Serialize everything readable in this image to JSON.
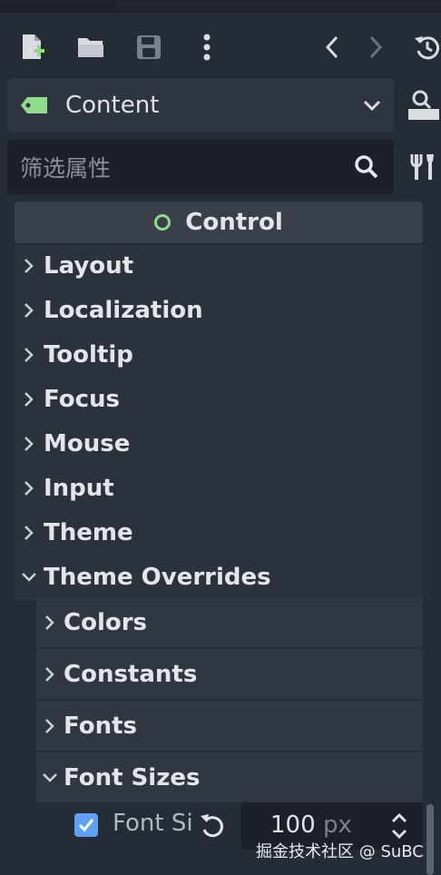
{
  "toolbar": {
    "icons": [
      "new-script-icon",
      "open-folder-icon",
      "save-icon",
      "more-vertical-icon",
      "back-icon",
      "forward-icon",
      "history-icon"
    ]
  },
  "resource": {
    "label": "Content"
  },
  "filter": {
    "placeholder": "筛选属性"
  },
  "section": {
    "title": "Control"
  },
  "categories": [
    "Layout",
    "Localization",
    "Tooltip",
    "Focus",
    "Mouse",
    "Input",
    "Theme",
    "Theme Overrides"
  ],
  "overrides": {
    "groups": [
      "Colors",
      "Constants",
      "Fonts",
      "Font Sizes"
    ]
  },
  "font_size_prop": {
    "label": "Font Si",
    "value": "100",
    "unit": "px",
    "checked": true
  },
  "watermark": "掘金技术社区 @ SuBC",
  "colors": {
    "accent": "#5ea1f2",
    "ring": "#8edb8a",
    "tag": "#8edb8a"
  }
}
